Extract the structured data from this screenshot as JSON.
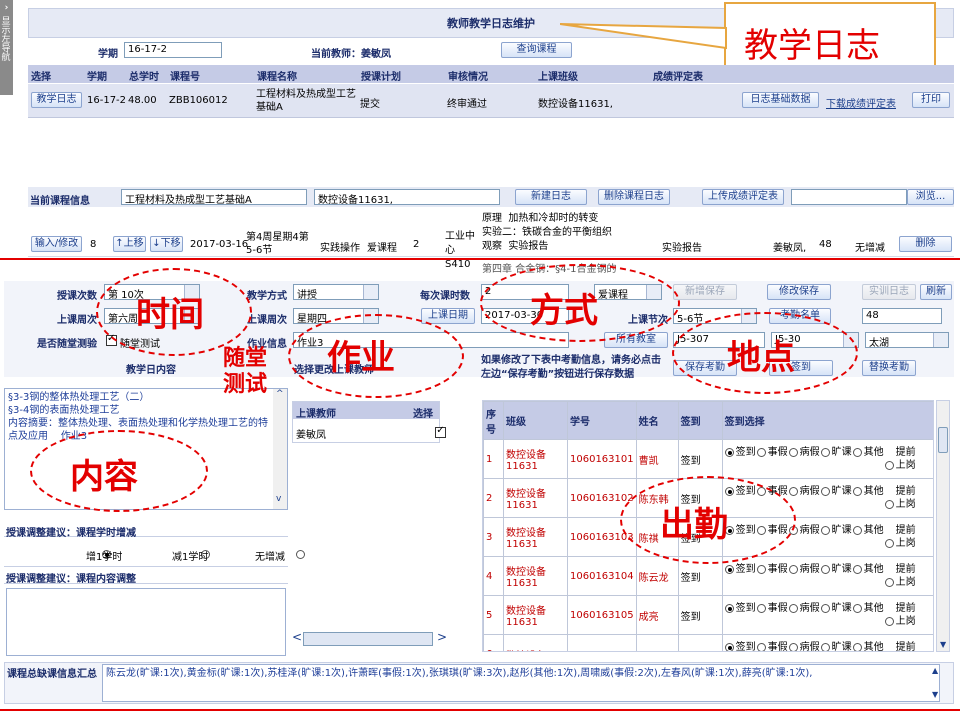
{
  "sidebar_toggle": {
    "label": "显示左导航"
  },
  "page_title": "教师教学日志维护",
  "callout": {
    "label": "教学日志"
  },
  "filter": {
    "term_label": "学期",
    "term_value": "16-17-2",
    "teacher_label": "当前教师：姜敏凤",
    "query_button": "查询课程"
  },
  "course_table": {
    "headers": [
      "选择",
      "学期",
      "总学时",
      "课程号",
      "课程名称",
      "授课计划",
      "审核情况",
      "上课班级",
      "成绩评定表"
    ],
    "row": {
      "select_button": "教学日志",
      "term": "16-17-2",
      "hours": "48.00",
      "code": "ZBB106012",
      "name": "工程材料及热成型工艺基础A",
      "plan": "提交",
      "review": "终审通过",
      "class": "数控设备11631,",
      "log_button": "日志基础数据",
      "download_link": "下载成绩评定表",
      "print_link": "打印"
    }
  },
  "current_course": {
    "label": "当前课程信息",
    "course": "工程材料及热成型工艺基础A",
    "class": "数控设备11631,",
    "new_log": "新建日志",
    "delete_log": "删除课程日志",
    "upload": "上传成绩评定表",
    "browse": "浏览..."
  },
  "log_row": {
    "edit_button": "输入/修改",
    "no": "8",
    "up": "↑上移",
    "down": "↓下移",
    "date": "2017-03-16",
    "week": "第4周星期4第5-6节",
    "method": "实践操作",
    "test": "爱课程",
    "hours": "2",
    "room": "工业中心S410",
    "content": "原理  加热和冷却时的转变\n实验二：铁碳合金的平衡组织观察  实验报告",
    "homework": "实验报告",
    "teacher": "姜敏凤,",
    "total": "48",
    "adjust": "无增减",
    "delete": "删除"
  },
  "behind_text": "第四章  合金钢：§4-1合金钢的",
  "form": {
    "session_label": "授课次数",
    "session_value": "第 10次",
    "method_label": "教学方式",
    "method_value": "讲授",
    "hours_label": "每次课时数",
    "hours_value": "2",
    "platform_value": "爱课程",
    "new_save": "新增保存",
    "edit_save": "修改保存",
    "practice_log": "实训日志",
    "refresh": "刷新",
    "week_label": "上课周次",
    "week_value": "第六周",
    "weekday_label": "上课周次",
    "weekday_value": "星期四",
    "date_button": "上课日期",
    "date_value": "2017-03-30",
    "period_label": "上课节次",
    "period_value": "5-6节",
    "roll_call": "考勤名单",
    "roll_value": "48",
    "test_label": "是否随堂测验",
    "test_checkbox": "随堂测试",
    "homework_label": "作业信息",
    "homework_value": "作业3",
    "all_rooms": "所有教室",
    "room_a": "J5-307",
    "room_b": "J5-30",
    "campus": "太湖",
    "content_label": "教学日内容",
    "change_teacher": "选择更改上课教师",
    "note": "如果修改了下表中考勤信息，请务必点击左边“保存考勤”按钮进行保存数据",
    "save_attendance": "保存考勤",
    "sign_all": "签到",
    "swap_attendance": "替换考勤"
  },
  "content_text": "§3-3钢的整体热处理工艺（二）\n§3-4钢的表面热处理工艺\n内容摘要：整体热处理、表面热处理和化学热处理工艺的特点及应用    作业3",
  "teacher_table": {
    "headers": [
      "上课教师",
      "选择"
    ],
    "rows": [
      {
        "name": "姜敏凤",
        "checked": true
      }
    ]
  },
  "attendance": {
    "headers": [
      "序号",
      "班级",
      "学号",
      "姓名",
      "签到",
      "签到选择"
    ],
    "options": [
      "签到",
      "事假",
      "病假",
      "旷课",
      "其他",
      "提前上岗"
    ],
    "rows": [
      {
        "no": "1",
        "class": "数控设备11631",
        "id": "1060163101",
        "name": "曹凯",
        "status": "签到"
      },
      {
        "no": "2",
        "class": "数控设备11631",
        "id": "1060163102",
        "name": "陈东韩",
        "status": "签到"
      },
      {
        "no": "3",
        "class": "数控设备11631",
        "id": "1060163103",
        "name": "陈祺",
        "status": "签到"
      },
      {
        "no": "4",
        "class": "数控设备11631",
        "id": "1060163104",
        "name": "陈云龙",
        "status": "签到"
      },
      {
        "no": "5",
        "class": "数控设备11631",
        "id": "1060163105",
        "name": "成亮",
        "status": "签到"
      },
      {
        "no": "6",
        "class": "数控设备",
        "id": "",
        "name": "",
        "status": ""
      }
    ]
  },
  "adjust_hours": {
    "label": "授课调整建议：课程学时增减",
    "options": [
      "增1学时",
      "减1学时",
      "无增减"
    ]
  },
  "adjust_content": {
    "label": "授课调整建议：课程内容调整"
  },
  "summary": {
    "label": "课程总缺课信息汇总",
    "text": "陈云龙(旷课:1次),黄金标(旷课:1次),苏桂泽(旷课:1次),许萧晖(事假:1次),张琪琪(旷课:3次),赵彤(其他:1次),周啸威(事假:2次),左春风(旷课:1次),薛亮(旷课:1次),"
  },
  "annotations": {
    "time": "时间",
    "method": "方式",
    "homework": "作业",
    "test": "随堂\n测试",
    "place": "地点",
    "content": "内容",
    "attendance": "出勤"
  },
  "colors": {
    "header_band": "#c5cbe6",
    "title_bar": "#e6eaf5",
    "label_blue": "#1c2d6b",
    "annotation_red": "#e30000",
    "selected_row": "#e0e4f2"
  }
}
